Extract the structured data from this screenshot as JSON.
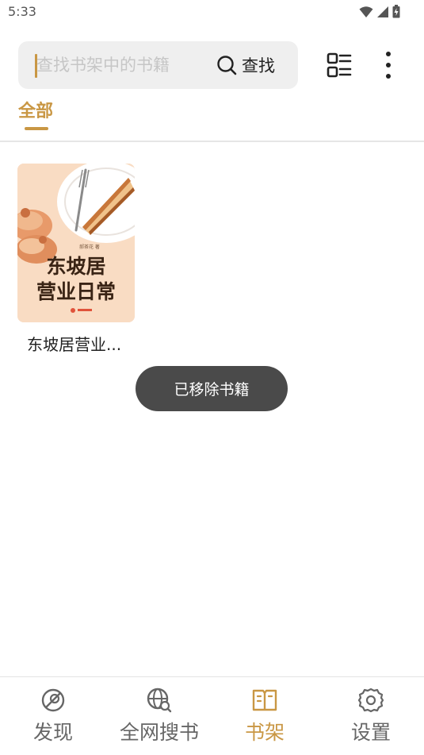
{
  "status_bar": {
    "time": "5:33"
  },
  "search": {
    "placeholder": "查找书架中的书籍",
    "value": "",
    "button_label": "查找"
  },
  "tabs": [
    {
      "label": "全部",
      "active": true
    }
  ],
  "books": [
    {
      "title": "东坡居营业...",
      "cover_text_line1": "东坡居",
      "cover_text_line2": "营业日常"
    }
  ],
  "toast": {
    "message": "已移除书籍"
  },
  "bottom_nav": {
    "items": [
      {
        "label": "发现",
        "icon": "compass-icon",
        "active": false
      },
      {
        "label": "全网搜书",
        "icon": "globe-search-icon",
        "active": false
      },
      {
        "label": "书架",
        "icon": "bookshelf-icon",
        "active": true
      },
      {
        "label": "设置",
        "icon": "gear-icon",
        "active": false
      }
    ]
  },
  "colors": {
    "accent": "#c99744",
    "toast_bg": "#4a4a4a",
    "search_bg": "#efefef"
  }
}
